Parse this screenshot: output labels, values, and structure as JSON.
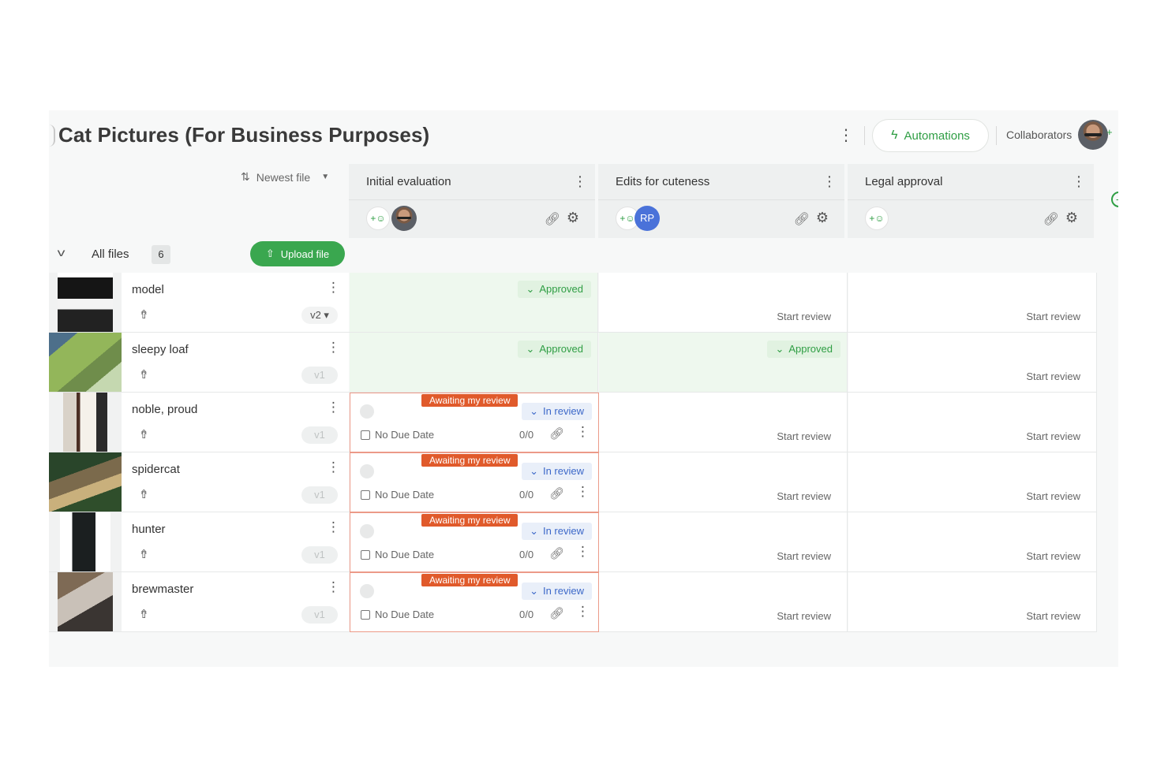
{
  "header": {
    "title": "Cat Pictures (For Business Purposes)",
    "more_icon": "⋮",
    "automations_label": "Automations",
    "automations_icon": "bolt-icon",
    "collaborators_label": "Collaborators",
    "add_collaborator": "+"
  },
  "sort": {
    "label": "Newest file"
  },
  "stages": [
    {
      "name": "Initial evaluation",
      "reviewers": [
        "photo"
      ]
    },
    {
      "name": "Edits for cuteness",
      "reviewers": [
        "RP"
      ]
    },
    {
      "name": "Legal approval",
      "reviewers": []
    }
  ],
  "files_bar": {
    "label": "All files",
    "count": "6",
    "upload_label": "Upload file"
  },
  "review_labels": {
    "approved": "Approved",
    "in_review": "In review",
    "awaiting": "Awaiting my review",
    "no_due_date": "No Due Date",
    "task_count": "0/0",
    "start_review": "Start review"
  },
  "files": [
    {
      "name": "model",
      "version": "v2",
      "statuses": [
        "approved",
        "start",
        "start"
      ]
    },
    {
      "name": "sleepy loaf",
      "version": "v1",
      "statuses": [
        "approved",
        "approved",
        "start"
      ]
    },
    {
      "name": "noble, proud",
      "version": "v1",
      "statuses": [
        "in_review",
        "start",
        "start"
      ]
    },
    {
      "name": "spidercat",
      "version": "v1",
      "statuses": [
        "in_review",
        "start",
        "start"
      ]
    },
    {
      "name": "hunter",
      "version": "v1",
      "statuses": [
        "in_review",
        "start",
        "start"
      ]
    },
    {
      "name": "brewmaster",
      "version": "v1",
      "statuses": [
        "in_review",
        "start",
        "start"
      ]
    }
  ],
  "colors": {
    "accent": "#2f9e44",
    "awaiting": "#e05a2b",
    "in_review": "#3c68c9"
  }
}
